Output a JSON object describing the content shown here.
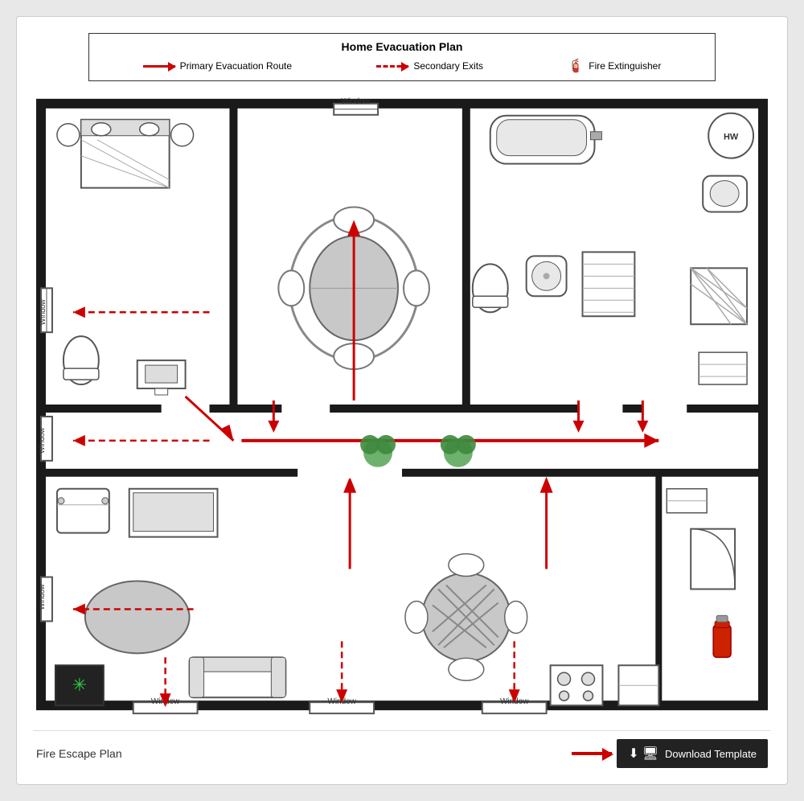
{
  "title": "Home Evacuation Plan",
  "legend": {
    "primary_label": "Primary Evacuation Route",
    "secondary_label": "Secondary Exits",
    "extinguisher_label": "Fire Extinguisher"
  },
  "footer": {
    "plan_label": "Fire Escape Plan",
    "download_label": "Download Template"
  },
  "windows": [
    "Window",
    "Window",
    "Window",
    "Window",
    "Window",
    "Window",
    "Window"
  ],
  "colors": {
    "wall": "#1a1a1a",
    "arrow_primary": "#cc0000",
    "arrow_secondary": "#cc0000",
    "furniture": "#888",
    "plant": "#4a9e4a",
    "floor": "#ffffff"
  }
}
